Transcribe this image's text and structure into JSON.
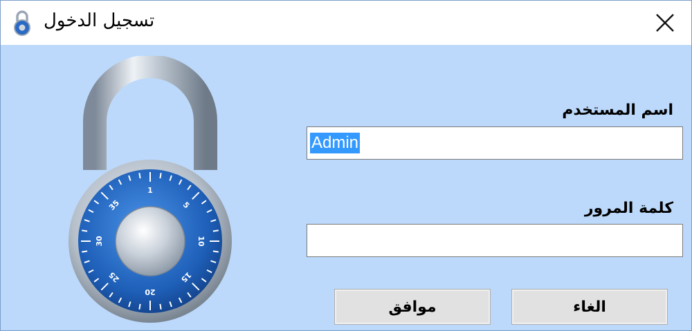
{
  "window": {
    "title": "تسجيل الدخول",
    "close_icon": "close-icon"
  },
  "form": {
    "username_label": "اسم المستخدم",
    "username_value": "Admin",
    "password_label": "كلمة المرور",
    "password_value": ""
  },
  "buttons": {
    "ok_label": "موافق",
    "cancel_label": "الغاء"
  },
  "lock_dial": {
    "numbers": [
      "1",
      "5",
      "10",
      "15",
      "20",
      "25",
      "30",
      "35"
    ]
  },
  "colors": {
    "background": "#bcd9fb",
    "dial_blue": "#1e5fb8",
    "selection": "#3399ff"
  }
}
